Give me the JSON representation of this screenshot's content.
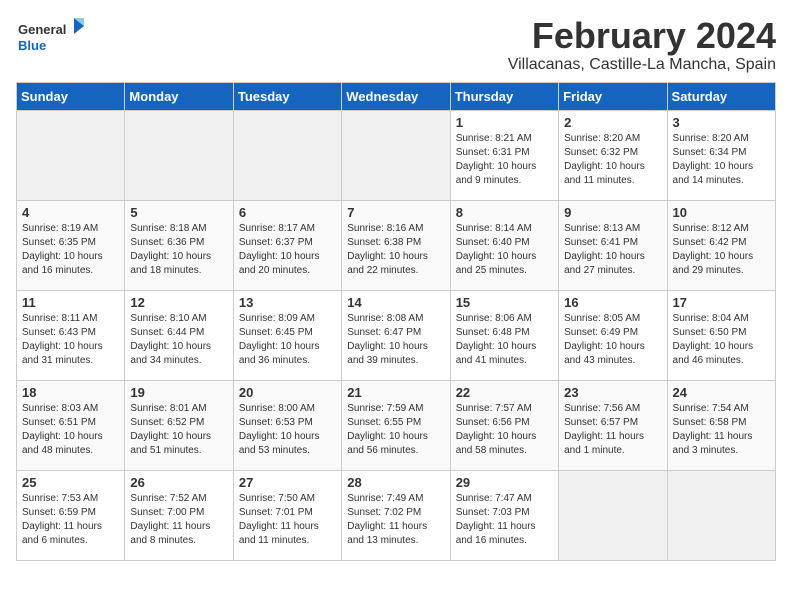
{
  "header": {
    "logo_general": "General",
    "logo_blue": "Blue",
    "title": "February 2024",
    "subtitle": "Villacanas, Castille-La Mancha, Spain"
  },
  "days_of_week": [
    "Sunday",
    "Monday",
    "Tuesday",
    "Wednesday",
    "Thursday",
    "Friday",
    "Saturday"
  ],
  "weeks": [
    [
      {
        "day": "",
        "info": ""
      },
      {
        "day": "",
        "info": ""
      },
      {
        "day": "",
        "info": ""
      },
      {
        "day": "",
        "info": ""
      },
      {
        "day": "1",
        "info": "Sunrise: 8:21 AM\nSunset: 6:31 PM\nDaylight: 10 hours and 9 minutes."
      },
      {
        "day": "2",
        "info": "Sunrise: 8:20 AM\nSunset: 6:32 PM\nDaylight: 10 hours and 11 minutes."
      },
      {
        "day": "3",
        "info": "Sunrise: 8:20 AM\nSunset: 6:34 PM\nDaylight: 10 hours and 14 minutes."
      }
    ],
    [
      {
        "day": "4",
        "info": "Sunrise: 8:19 AM\nSunset: 6:35 PM\nDaylight: 10 hours and 16 minutes."
      },
      {
        "day": "5",
        "info": "Sunrise: 8:18 AM\nSunset: 6:36 PM\nDaylight: 10 hours and 18 minutes."
      },
      {
        "day": "6",
        "info": "Sunrise: 8:17 AM\nSunset: 6:37 PM\nDaylight: 10 hours and 20 minutes."
      },
      {
        "day": "7",
        "info": "Sunrise: 8:16 AM\nSunset: 6:38 PM\nDaylight: 10 hours and 22 minutes."
      },
      {
        "day": "8",
        "info": "Sunrise: 8:14 AM\nSunset: 6:40 PM\nDaylight: 10 hours and 25 minutes."
      },
      {
        "day": "9",
        "info": "Sunrise: 8:13 AM\nSunset: 6:41 PM\nDaylight: 10 hours and 27 minutes."
      },
      {
        "day": "10",
        "info": "Sunrise: 8:12 AM\nSunset: 6:42 PM\nDaylight: 10 hours and 29 minutes."
      }
    ],
    [
      {
        "day": "11",
        "info": "Sunrise: 8:11 AM\nSunset: 6:43 PM\nDaylight: 10 hours and 31 minutes."
      },
      {
        "day": "12",
        "info": "Sunrise: 8:10 AM\nSunset: 6:44 PM\nDaylight: 10 hours and 34 minutes."
      },
      {
        "day": "13",
        "info": "Sunrise: 8:09 AM\nSunset: 6:45 PM\nDaylight: 10 hours and 36 minutes."
      },
      {
        "day": "14",
        "info": "Sunrise: 8:08 AM\nSunset: 6:47 PM\nDaylight: 10 hours and 39 minutes."
      },
      {
        "day": "15",
        "info": "Sunrise: 8:06 AM\nSunset: 6:48 PM\nDaylight: 10 hours and 41 minutes."
      },
      {
        "day": "16",
        "info": "Sunrise: 8:05 AM\nSunset: 6:49 PM\nDaylight: 10 hours and 43 minutes."
      },
      {
        "day": "17",
        "info": "Sunrise: 8:04 AM\nSunset: 6:50 PM\nDaylight: 10 hours and 46 minutes."
      }
    ],
    [
      {
        "day": "18",
        "info": "Sunrise: 8:03 AM\nSunset: 6:51 PM\nDaylight: 10 hours and 48 minutes."
      },
      {
        "day": "19",
        "info": "Sunrise: 8:01 AM\nSunset: 6:52 PM\nDaylight: 10 hours and 51 minutes."
      },
      {
        "day": "20",
        "info": "Sunrise: 8:00 AM\nSunset: 6:53 PM\nDaylight: 10 hours and 53 minutes."
      },
      {
        "day": "21",
        "info": "Sunrise: 7:59 AM\nSunset: 6:55 PM\nDaylight: 10 hours and 56 minutes."
      },
      {
        "day": "22",
        "info": "Sunrise: 7:57 AM\nSunset: 6:56 PM\nDaylight: 10 hours and 58 minutes."
      },
      {
        "day": "23",
        "info": "Sunrise: 7:56 AM\nSunset: 6:57 PM\nDaylight: 11 hours and 1 minute."
      },
      {
        "day": "24",
        "info": "Sunrise: 7:54 AM\nSunset: 6:58 PM\nDaylight: 11 hours and 3 minutes."
      }
    ],
    [
      {
        "day": "25",
        "info": "Sunrise: 7:53 AM\nSunset: 6:59 PM\nDaylight: 11 hours and 6 minutes."
      },
      {
        "day": "26",
        "info": "Sunrise: 7:52 AM\nSunset: 7:00 PM\nDaylight: 11 hours and 8 minutes."
      },
      {
        "day": "27",
        "info": "Sunrise: 7:50 AM\nSunset: 7:01 PM\nDaylight: 11 hours and 11 minutes."
      },
      {
        "day": "28",
        "info": "Sunrise: 7:49 AM\nSunset: 7:02 PM\nDaylight: 11 hours and 13 minutes."
      },
      {
        "day": "29",
        "info": "Sunrise: 7:47 AM\nSunset: 7:03 PM\nDaylight: 11 hours and 16 minutes."
      },
      {
        "day": "",
        "info": ""
      },
      {
        "day": "",
        "info": ""
      }
    ]
  ]
}
